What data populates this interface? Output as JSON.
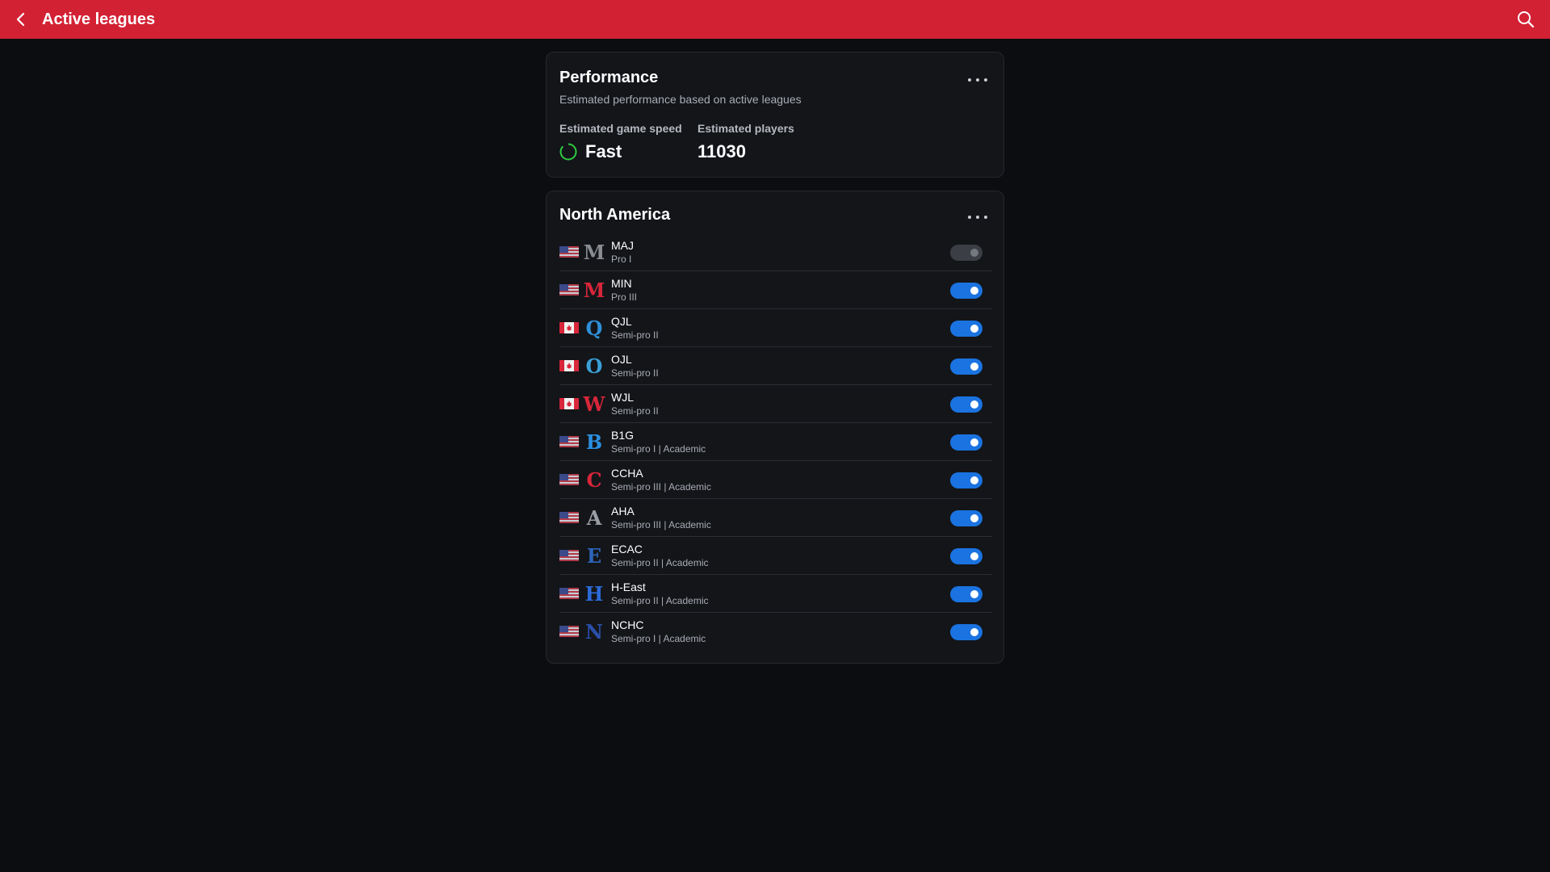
{
  "header": {
    "title": "Active leagues",
    "back_icon": "chevron-left-icon",
    "search_icon": "search-icon",
    "bg_color": "#d32134"
  },
  "performance": {
    "title": "Performance",
    "subtitle": "Estimated performance based on active leagues",
    "game_speed_label": "Estimated game speed",
    "game_speed_value": "Fast",
    "players_label": "Estimated players",
    "players_value": "11030",
    "speed_indicator_color": "#2ecc40"
  },
  "region": {
    "title": "North America",
    "leagues": [
      {
        "name": "MAJ",
        "level": "Pro I",
        "flag": "us",
        "logo": "M",
        "logo_color": "#8a8d92",
        "enabled": false
      },
      {
        "name": "MIN",
        "level": "Pro III",
        "flag": "us",
        "logo": "M",
        "logo_color": "#d8263a",
        "enabled": true
      },
      {
        "name": "QJL",
        "level": "Semi-pro II",
        "flag": "ca",
        "logo": "Q",
        "logo_color": "#2f8fd8",
        "enabled": true
      },
      {
        "name": "OJL",
        "level": "Semi-pro II",
        "flag": "ca",
        "logo": "O",
        "logo_color": "#3aa0d8",
        "enabled": true
      },
      {
        "name": "WJL",
        "level": "Semi-pro II",
        "flag": "ca",
        "logo": "W",
        "logo_color": "#d8263a",
        "enabled": true
      },
      {
        "name": "B1G",
        "level": "Semi-pro I | Academic",
        "flag": "us",
        "logo": "B",
        "logo_color": "#2b8fe0",
        "enabled": true
      },
      {
        "name": "CCHA",
        "level": "Semi-pro III | Academic",
        "flag": "us",
        "logo": "C",
        "logo_color": "#d8263a",
        "enabled": true
      },
      {
        "name": "AHA",
        "level": "Semi-pro III | Academic",
        "flag": "us",
        "logo": "A",
        "logo_color": "#9a9da3",
        "enabled": true
      },
      {
        "name": "ECAC",
        "level": "Semi-pro II | Academic",
        "flag": "us",
        "logo": "E",
        "logo_color": "#2c64b8",
        "enabled": true
      },
      {
        "name": "H-East",
        "level": "Semi-pro II | Academic",
        "flag": "us",
        "logo": "H",
        "logo_color": "#2c6ad8",
        "enabled": true
      },
      {
        "name": "NCHC",
        "level": "Semi-pro I | Academic",
        "flag": "us",
        "logo": "N",
        "logo_color": "#2a4ea8",
        "enabled": true
      }
    ]
  },
  "toggle_on_color": "#1a73e0"
}
